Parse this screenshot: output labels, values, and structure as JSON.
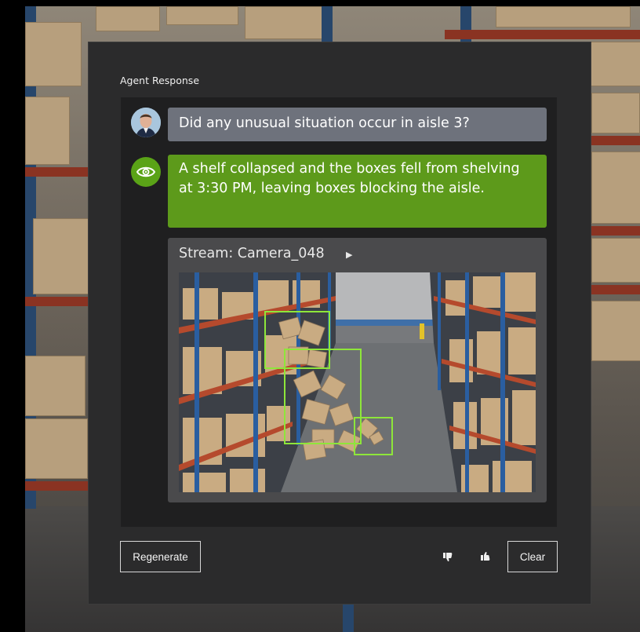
{
  "panel": {
    "title": "Agent Response"
  },
  "messages": {
    "user": "Did any unusual situation occur in aisle 3?",
    "agent": "A shelf collapsed and the boxes fell from shelving at 3:30 PM, leaving boxes blocking the aisle."
  },
  "stream": {
    "label": "Stream: Camera_048",
    "play_icon": "play-triangle-icon"
  },
  "footer": {
    "regenerate_label": "Regenerate",
    "clear_label": "Clear",
    "thumbs_down_icon": "thumbs-down-icon",
    "thumbs_up_icon": "thumbs-up-icon"
  },
  "colors": {
    "agent_bubble": "#5d9a1b",
    "user_bubble": "#6e727c",
    "detection_box": "#8ee63a",
    "panel": "#2b2b2c"
  }
}
